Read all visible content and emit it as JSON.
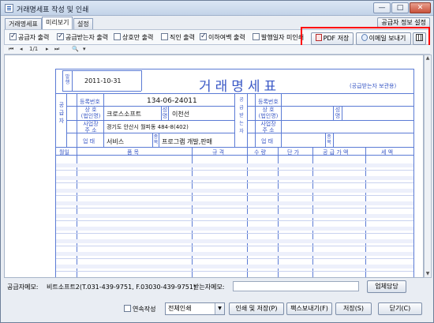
{
  "window": {
    "title": "거래명세표 작성 및 인쇄",
    "minimize": "—",
    "maximize": "□",
    "close": "✕"
  },
  "tabs": [
    {
      "label": "거래명세표",
      "active": false
    },
    {
      "label": "미리보기",
      "active": true
    },
    {
      "label": "설정",
      "active": false
    }
  ],
  "supplier_info_button": "공급자 정보 설정",
  "options": [
    {
      "label": "공급자 출력",
      "checked": true
    },
    {
      "label": "공급받는자 출력",
      "checked": true
    },
    {
      "label": "상호만 출력",
      "checked": false
    },
    {
      "label": "직인 출력",
      "checked": false
    },
    {
      "label": "이하여백 출력",
      "checked": true
    },
    {
      "label": "발행일자 미인쇄",
      "checked": false
    }
  ],
  "toolbar": {
    "pdf_label": "PDF 저장",
    "email_label": "이메일 보내기"
  },
  "nav": {
    "page": "1/1",
    "first": "⏮",
    "prev": "◂",
    "next": "▸",
    "last": "⏭",
    "zoom": "🔍"
  },
  "invoice": {
    "issue_label": "발행",
    "issue_date": "2011-10-31",
    "title": "거래명세표",
    "copy_label": "(공급받는자 보관용)",
    "supplier_side_label": "공급자",
    "receiver_side_label": "공급받는자",
    "reg_no_label": "등록번호",
    "reg_no": "134-06-24011",
    "company_label": "상 호\n(법인명)",
    "company": "크로스소프트",
    "name_label": "성명",
    "name": "이천선",
    "address_label": "사업장\n주 소",
    "address": "경기도 안산시 월피동 484-8(402)",
    "biz_type_label": "업 태",
    "biz_type": "서비스",
    "item_label": "종목",
    "item": "프로그램 개발,판매",
    "columns": [
      "월일",
      "품 목",
      "규 격",
      "수 량",
      "단 가",
      "공 급 가 액",
      "세 액"
    ]
  },
  "memo": {
    "supplier_memo_label": "공급자메모:",
    "supplier_memo": "비트소프트2(T.031-439-9751, F.03030-439-9751)",
    "receiver_memo_label": "받는자메모:",
    "vendor_button": "업체담당"
  },
  "bottom": {
    "continuous_label": "연속작성",
    "print_select": "전체인쇄",
    "print_save_button": "인쇄 및 저장(P)",
    "fax_button": "팩스보내기(F)",
    "save_button": "저장(S)",
    "close_button": "닫기(C)"
  }
}
